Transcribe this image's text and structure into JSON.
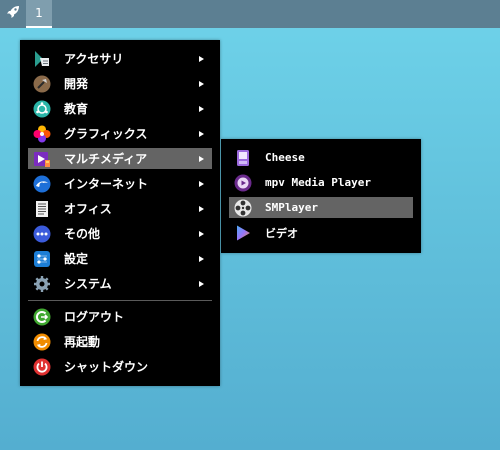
{
  "panel": {
    "launcher_icon": "rocket-icon",
    "workspace": "1"
  },
  "main_menu": {
    "items": [
      {
        "label": "アクセサリ",
        "icon": "accessories-icon",
        "has_submenu": true
      },
      {
        "label": "開発",
        "icon": "development-icon",
        "has_submenu": true
      },
      {
        "label": "教育",
        "icon": "education-icon",
        "has_submenu": true
      },
      {
        "label": "グラフィックス",
        "icon": "graphics-icon",
        "has_submenu": true
      },
      {
        "label": "マルチメディア",
        "icon": "multimedia-icon",
        "has_submenu": true,
        "highlighted": true
      },
      {
        "label": "インターネット",
        "icon": "internet-icon",
        "has_submenu": true
      },
      {
        "label": "オフィス",
        "icon": "office-icon",
        "has_submenu": true
      },
      {
        "label": "その他",
        "icon": "other-icon",
        "has_submenu": true
      },
      {
        "label": "設定",
        "icon": "settings-icon",
        "has_submenu": true
      },
      {
        "label": "システム",
        "icon": "system-icon",
        "has_submenu": true
      }
    ],
    "session_items": [
      {
        "label": "ログアウト",
        "icon": "logout-icon"
      },
      {
        "label": "再起動",
        "icon": "reboot-icon"
      },
      {
        "label": "シャットダウン",
        "icon": "shutdown-icon"
      }
    ]
  },
  "sub_menu": {
    "items": [
      {
        "label": "Cheese",
        "icon": "cheese-icon"
      },
      {
        "label": "mpv Media Player",
        "icon": "mpv-icon"
      },
      {
        "label": "SMPlayer",
        "icon": "smplayer-icon",
        "highlighted": true
      },
      {
        "label": "ビデオ",
        "icon": "video-icon"
      }
    ]
  },
  "colors": {
    "panel": "#5c7f92",
    "menu_bg": "#000000",
    "highlight": "#646464",
    "desktop": "#62c2dd"
  }
}
